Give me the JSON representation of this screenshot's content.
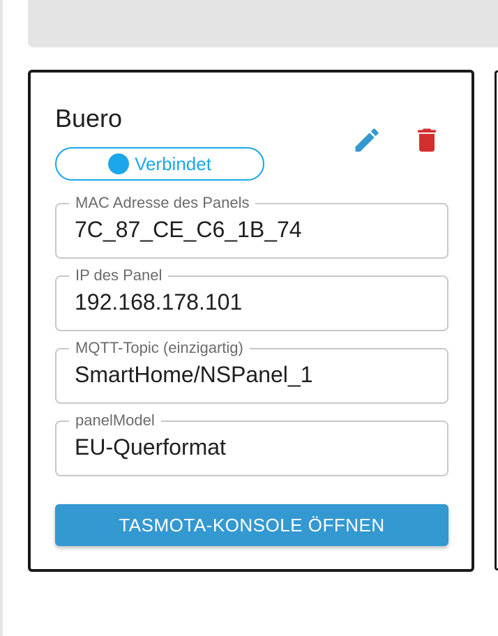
{
  "panel": {
    "name": "Buero",
    "status": "Verbindet",
    "fields": [
      {
        "label": "MAC Adresse des Panels",
        "value": "7C_87_CE_C6_1B_74"
      },
      {
        "label": "IP des Panel",
        "value": "192.168.178.101"
      },
      {
        "label": "MQTT-Topic (einzigartig)",
        "value": "SmartHome/NSPanel_1"
      },
      {
        "label": "panelModel",
        "value": "EU-Querformat"
      }
    ],
    "console_button": "TASMOTA-KONSOLE ÖFFNEN"
  },
  "icons": {
    "edit": "pencil-icon",
    "delete": "trash-icon"
  },
  "colors": {
    "accent": "#1ba7ea",
    "button": "#3498d1",
    "delete": "#d32f2f",
    "edit": "#3498d1"
  }
}
